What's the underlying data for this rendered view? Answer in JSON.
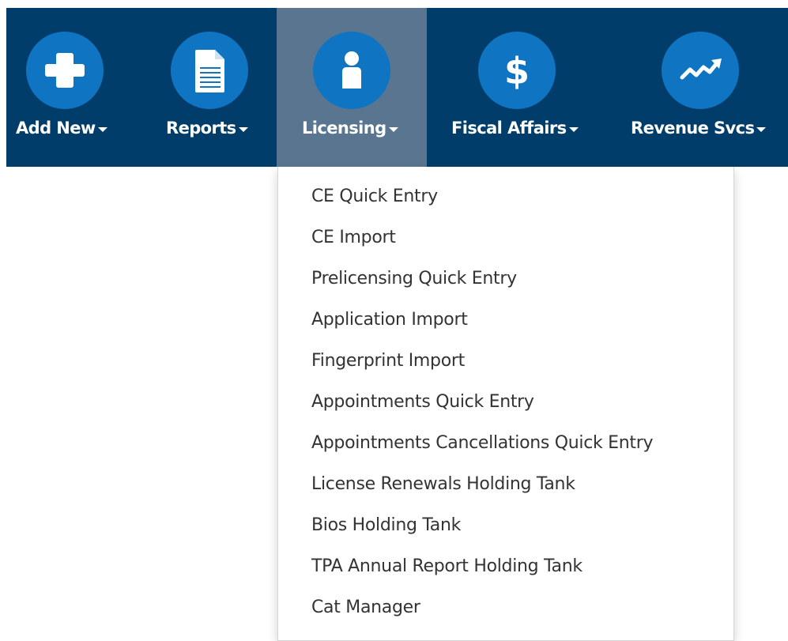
{
  "nav": {
    "add_new": {
      "label": "Add New",
      "icon": "plus-icon"
    },
    "reports": {
      "label": "Reports",
      "icon": "document-icon"
    },
    "licensing": {
      "label": "Licensing",
      "icon": "person-icon",
      "active": true
    },
    "fiscal_affairs": {
      "label": "Fiscal Affairs",
      "icon": "dollar-icon"
    },
    "revenue_svcs": {
      "label": "Revenue Svcs",
      "icon": "trending-up-icon"
    }
  },
  "dropdown": {
    "items": [
      "CE Quick Entry",
      "CE Import",
      "Prelicensing Quick Entry",
      "Application Import",
      "Fingerprint Import",
      "Appointments Quick Entry",
      "Appointments Cancellations Quick Entry",
      "License Renewals Holding Tank",
      "Bios Holding Tank",
      "TPA Annual Report Holding Tank",
      "Cat Manager"
    ]
  },
  "colors": {
    "navbar_bg": "#013d6a",
    "active_bg": "#5a7590",
    "icon_circle": "#0f75c2",
    "menu_text": "#333333"
  }
}
